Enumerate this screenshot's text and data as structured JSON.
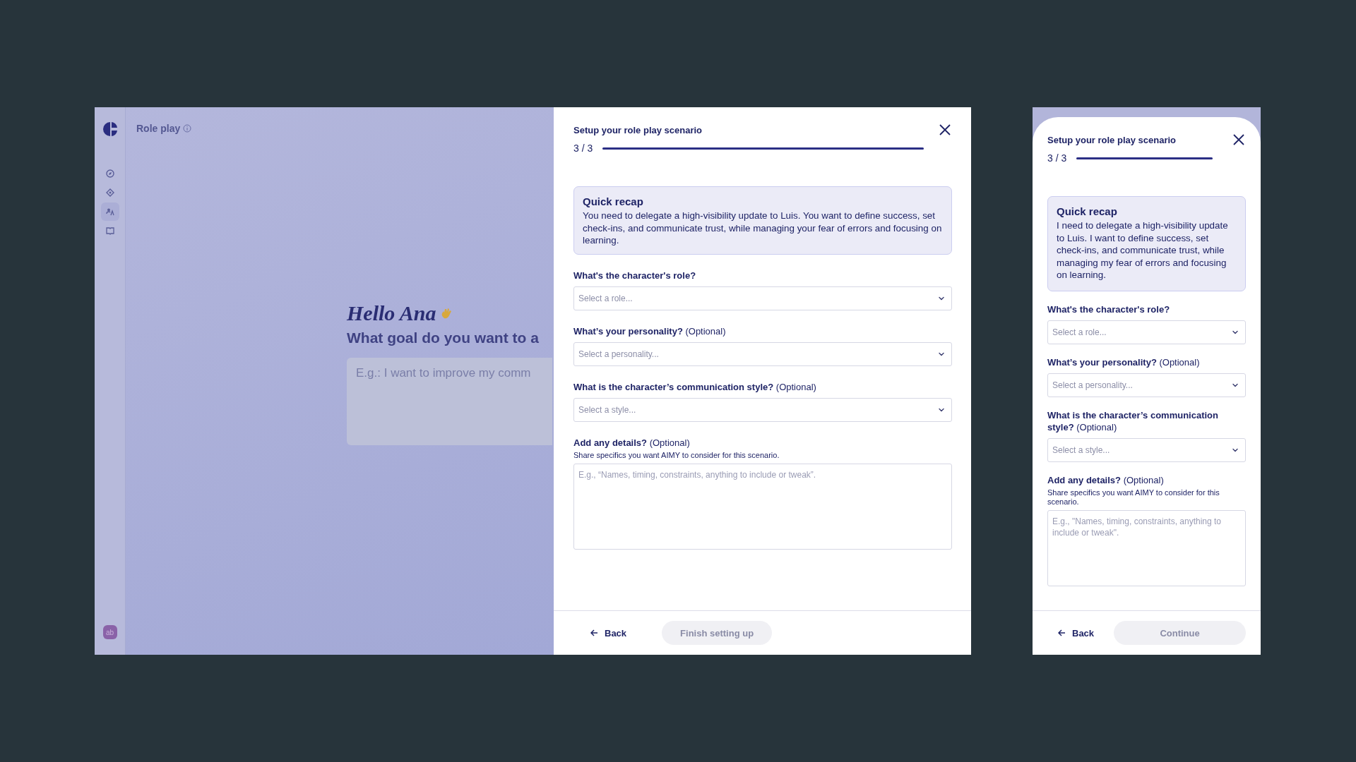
{
  "app": {
    "title": "Role play",
    "greeting": "Hello Ana",
    "question": "What goal do you want to a",
    "goal_field": {
      "placeholder": "E.g.: I want to improve my comm"
    },
    "sidebar": {
      "items": [
        {
          "selected": false
        },
        {
          "selected": false
        },
        {
          "selected": true
        },
        {
          "selected": false
        }
      ],
      "avatar": "ab"
    }
  },
  "dialogs": [
    {
      "kind": "desktop",
      "title": "Setup your role play scenario",
      "step": "3 / 3",
      "progress": {
        "level": 1
      },
      "recap": {
        "title": "Quick recap",
        "text": "You need to delegate a high-visibility update to Luis. You want to define success, set check-ins, and communicate trust, while managing your fear of errors and focusing on learning."
      },
      "fields": [
        {
          "kind": "select",
          "label": "What's the character's role?",
          "placeholder": "Select a role..."
        },
        {
          "kind": "select",
          "label": "What’s your personality?",
          "optional": "(Optional)",
          "placeholder": "Select a personality..."
        },
        {
          "kind": "select",
          "label": "What is the character’s communication style?",
          "optional": "(Optional)",
          "placeholder": "Select a style..."
        },
        {
          "kind": "textarea",
          "label": "Add any details?",
          "optional": "(Optional)",
          "note": "Share specifics you want AIMY to consider for this scenario.",
          "placeholder": "E.g., “Names, timing, constraints, anything to include or tweak”."
        }
      ],
      "back": "Back",
      "primary": {
        "label": "Finish setting up",
        "disabled": true
      }
    },
    {
      "kind": "mobile",
      "title": "Setup your role play scenario",
      "step": "3 / 3",
      "progress": {
        "level": 1
      },
      "recap": {
        "title": "Quick recap",
        "text": "I need to delegate a high-visibility update to Luis. I want to define success, set check-ins, and communicate trust, while managing my fear of errors and focusing on learning."
      },
      "fields": [
        {
          "kind": "select",
          "label": "What's the character's role?",
          "placeholder": "Select a role..."
        },
        {
          "kind": "select",
          "label": "What’s your personality?",
          "optional": "(Optional)",
          "placeholder": "Select a personality..."
        },
        {
          "kind": "select",
          "label": "What is the character’s communication style?",
          "optional": "(Optional)",
          "placeholder": "Select a style..."
        },
        {
          "kind": "textarea",
          "label": "Add any details?",
          "optional": "(Optional)",
          "note": "Share specifics you want AIMY to consider for this scenario.",
          "placeholder": "E.g., \"Names, timing, constraints, anything to include or tweak\"."
        }
      ],
      "back": "Back",
      "primary": {
        "label": "Continue",
        "disabled": true
      }
    }
  ]
}
